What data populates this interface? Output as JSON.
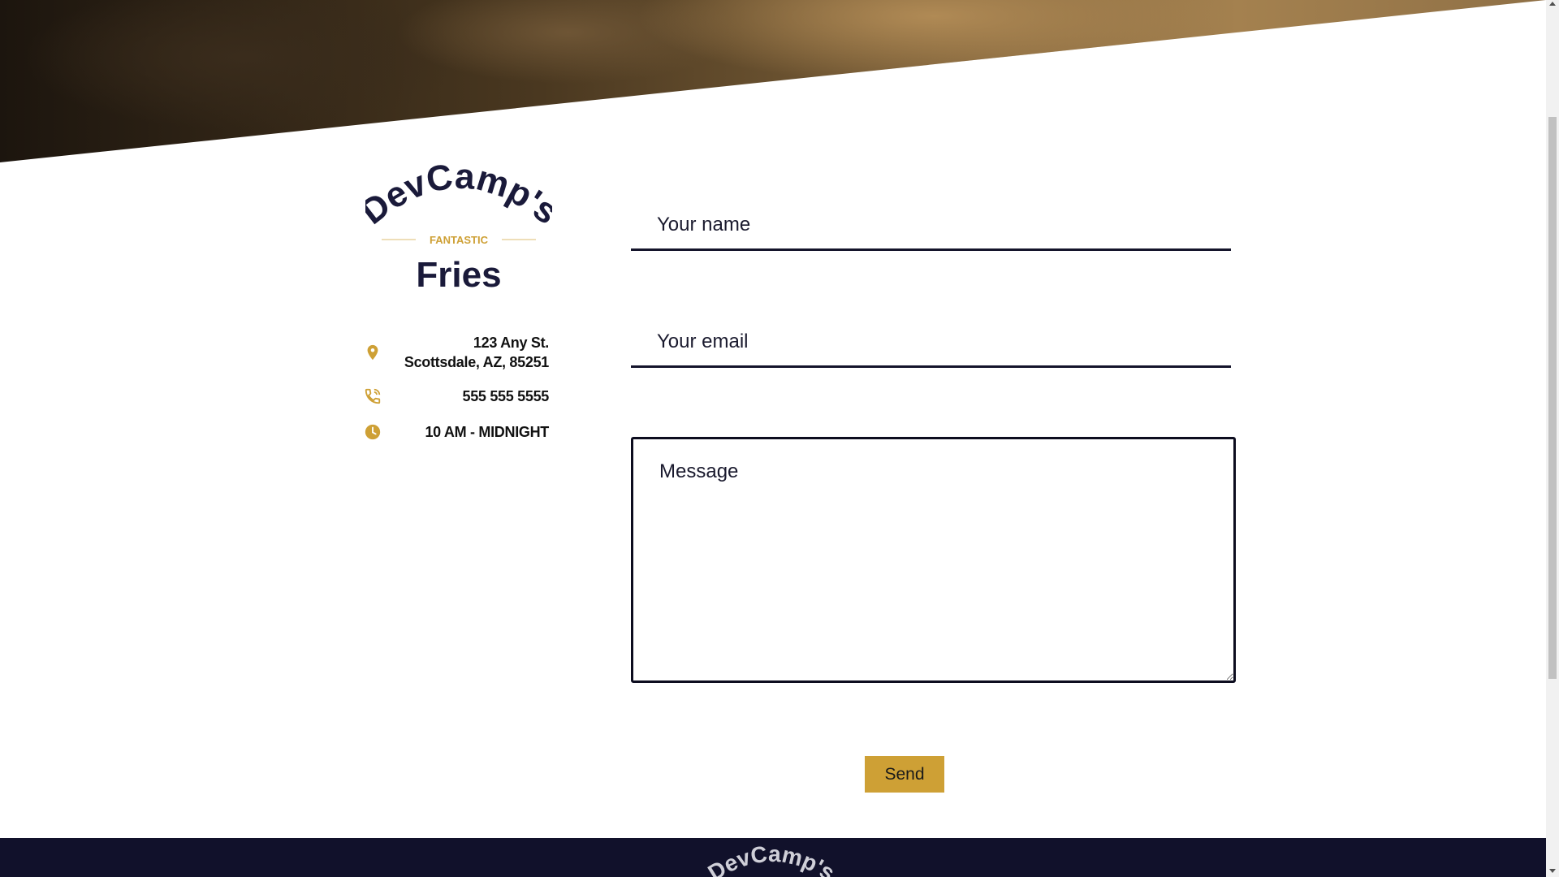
{
  "logo": {
    "brand": "DevCamp's",
    "tagline": "FANTASTIC",
    "product": "Fries",
    "colors": {
      "navy": "#1a1a3a",
      "gold": "#cea035"
    }
  },
  "contact": {
    "address_line1": "123 Any St.",
    "address_line2": "Scottsdale, AZ, 85251",
    "phone": "555 555 5555",
    "hours": "10 AM - MIDNIGHT",
    "icons": {
      "address": "map-pin-icon",
      "phone": "phone-icon",
      "hours": "clock-icon"
    },
    "icon_color": "#cea035"
  },
  "form": {
    "name_placeholder": "Your name",
    "email_placeholder": "Your email",
    "message_placeholder": "Message",
    "send_label": "Send",
    "accent": "#cea035"
  },
  "footer": {
    "logo_text": "DevCamp's",
    "background": "#11112b"
  }
}
